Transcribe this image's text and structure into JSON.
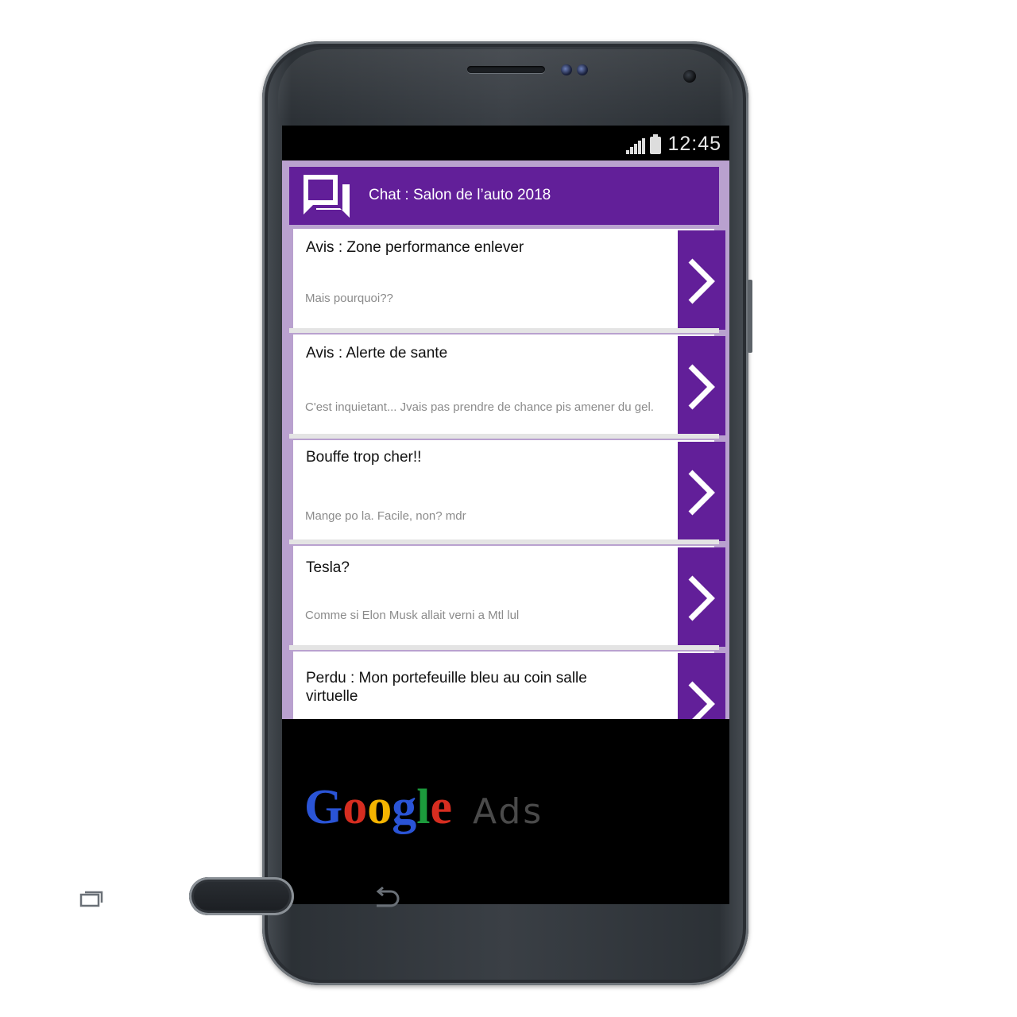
{
  "status_bar": {
    "time": "12:45"
  },
  "header": {
    "icon": "chat-bubbles-icon",
    "title": "Chat : Salon de l’auto 2018"
  },
  "threads": [
    {
      "title": "Avis : Zone performance enlever",
      "preview": "Mais pourquoi??"
    },
    {
      "title": "Avis : Alerte de sante",
      "preview": "C'est inquietant... Jvais pas prendre de chance pis amener du gel."
    },
    {
      "title": "Bouffe trop cher!!",
      "preview": "Mange po la. Facile, non? mdr"
    },
    {
      "title": "Tesla?",
      "preview": "Comme si Elon Musk allait verni a Mtl lul"
    },
    {
      "title": "Perdu : Mon portefeuille bleu au coin salle virtuelle",
      "preview": ""
    }
  ],
  "ad": {
    "letters": [
      "G",
      "o",
      "o",
      "g",
      "l",
      "e"
    ],
    "suffix": "Ads",
    "letter_colors": [
      "#2a54d6",
      "#d62d20",
      "#f4b400",
      "#2a54d6",
      "#1c9a3c",
      "#d62d20"
    ]
  },
  "colors": {
    "accent": "#621f99",
    "list_bg": "#b9a1cf",
    "separator": "#e4e4e4"
  },
  "nav": {
    "recent": "recent-apps-icon",
    "home": "home-button",
    "back": "back-arrow-icon"
  }
}
